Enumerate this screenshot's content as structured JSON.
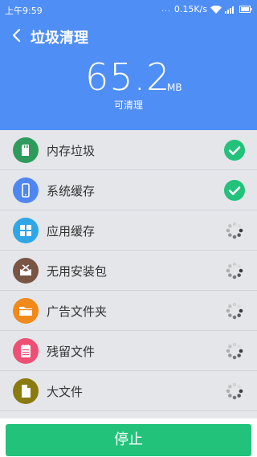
{
  "status_bar": {
    "time": "上午9:59",
    "dots": "...",
    "speed": "0.15K/s"
  },
  "header": {
    "title": "垃圾清理",
    "size_value": "65.2",
    "size_unit": "MB",
    "size_caption": "可清理"
  },
  "list": [
    {
      "label": "内存垃圾",
      "status": "done",
      "icon": "sd-card-icon",
      "color": "#2e9b5c"
    },
    {
      "label": "系统缓存",
      "status": "done",
      "icon": "phone-icon",
      "color": "#4f86f0"
    },
    {
      "label": "应用缓存",
      "status": "loading",
      "icon": "apps-grid-icon",
      "color": "#2ea7e8"
    },
    {
      "label": "无用安装包",
      "status": "loading",
      "icon": "package-box-icon",
      "color": "#7a5543"
    },
    {
      "label": "广告文件夹",
      "status": "loading",
      "icon": "folder-icon",
      "color": "#f08a1a"
    },
    {
      "label": "残留文件",
      "status": "loading",
      "icon": "notepad-icon",
      "color": "#ef4f74"
    },
    {
      "label": "大文件",
      "status": "loading",
      "icon": "document-icon",
      "color": "#8a7a10"
    }
  ],
  "footer": {
    "stop_label": "停止"
  },
  "colors": {
    "header_bg": "#4f8ef4",
    "accent_green": "#22c27a",
    "list_bg": "#e4e6ea"
  }
}
